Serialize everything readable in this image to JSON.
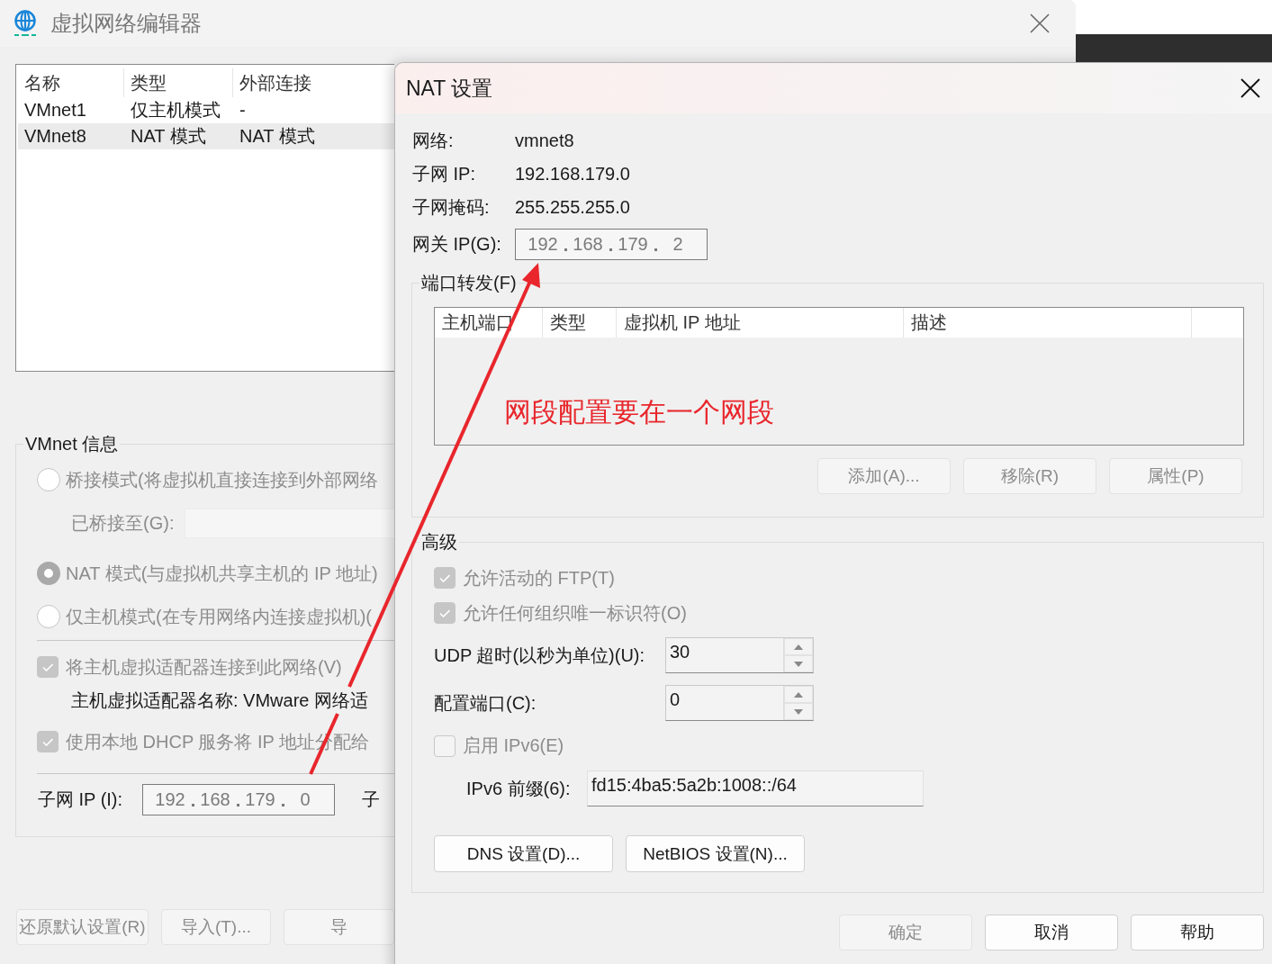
{
  "background_window": {
    "title": "虚拟网络编辑器",
    "network_list": {
      "columns": [
        "名称",
        "类型",
        "外部连接"
      ],
      "rows": [
        {
          "cells": [
            "VMnet1",
            "仅主机模式",
            "-"
          ],
          "selected": false
        },
        {
          "cells": [
            "VMnet8",
            "NAT 模式",
            "NAT 模式"
          ],
          "selected": true
        }
      ]
    },
    "vmnet_info": {
      "title": "VMnet 信息",
      "modes": [
        {
          "label": "桥接模式(将虚拟机直接连接到外部网络",
          "selected": false,
          "disabled": true
        },
        {
          "label": "NAT 模式(与虚拟机共享主机的 IP 地址)",
          "selected": true,
          "disabled": true
        },
        {
          "label": "仅主机模式(在专用网络内连接虚拟机)(",
          "selected": false,
          "disabled": true
        }
      ],
      "bridged_to_label": "已桥接至(G):",
      "checks": [
        {
          "label": "将主机虚拟适配器连接到此网络(V)",
          "checked": true,
          "disabled": true
        },
        {
          "label": "使用本地 DHCP 服务将 IP 地址分配给",
          "checked": true,
          "disabled": true
        }
      ],
      "adapter_name": "主机虚拟适配器名称: VMware 网络适",
      "subnet_ip": {
        "label": "子网 IP (I):",
        "octets": [
          "192",
          "168",
          "179",
          "0"
        ]
      },
      "column_2_label": "子"
    },
    "buttons": [
      "还原默认设置(R)",
      "导入(T)...",
      "导"
    ]
  },
  "nat_dialog": {
    "title": "NAT 设置",
    "info": [
      {
        "label": "网络:",
        "value": "vmnet8"
      },
      {
        "label": "子网 IP:",
        "value": "192.168.179.0"
      },
      {
        "label": "子网掩码:",
        "value": "255.255.255.0"
      }
    ],
    "gateway_ip": {
      "label": "网关 IP(G):",
      "octets": [
        "192",
        "168",
        "179",
        "2"
      ]
    },
    "port_forwarding": {
      "title": "端口转发(F)",
      "columns": [
        "主机端口",
        "类型",
        "虚拟机 IP 地址",
        "描述"
      ],
      "buttons": [
        {
          "label": "添加(A)...",
          "disabled": true
        },
        {
          "label": "移除(R)",
          "disabled": true
        },
        {
          "label": "属性(P)",
          "disabled": true
        }
      ]
    },
    "advanced": {
      "title": "高级",
      "options": [
        {
          "label": "允许活动的 FTP(T)",
          "checked": true,
          "disabled": true
        },
        {
          "label": "允许任何组织唯一标识符(O)",
          "checked": true,
          "disabled": true
        }
      ],
      "spinners": [
        {
          "label": "UDP 超时(以秒为单位)(U):",
          "value": "30"
        },
        {
          "label": "配置端口(C):",
          "value": "0"
        }
      ],
      "enable_ipv6": {
        "label": "启用 IPv6(E)",
        "checked": false,
        "disabled": true
      },
      "ipv6_prefix": {
        "label": "IPv6 前缀(6):",
        "value": "fd15:4ba5:5a2b:1008::/64"
      },
      "buttons": [
        "DNS 设置(D)...",
        "NetBIOS 设置(N)..."
      ]
    },
    "buttons": [
      {
        "label": "确定",
        "disabled": true
      },
      {
        "label": "取消",
        "disabled": false
      },
      {
        "label": "帮助",
        "disabled": false
      }
    ]
  },
  "annotation": {
    "text": "网段配置要在一个网段"
  }
}
